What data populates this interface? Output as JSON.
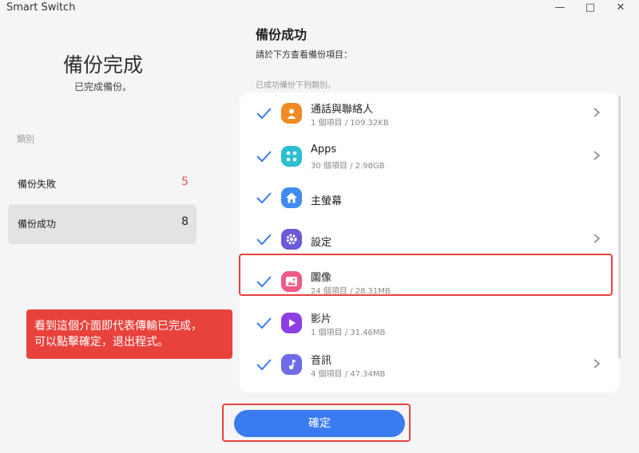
{
  "window": {
    "title": "Smart Switch",
    "controls": [
      "minimize-icon",
      "maximize-icon",
      "close-icon"
    ]
  },
  "summary": {
    "title": "備份完成",
    "subtitle": "已完成備份。",
    "category_label": "類別",
    "categories": [
      {
        "label": "備份失敗",
        "count": "5",
        "color": "#e05252",
        "selected": false
      },
      {
        "label": "備份成功",
        "count": "8",
        "color": "#222222",
        "selected": true
      }
    ]
  },
  "callout": {
    "line1": "看到這個介面即代表傳輸已完成，",
    "line2": "可以點擊確定，退出程式。"
  },
  "detail": {
    "title": "備份成功",
    "subtitle": "請於下方查看備份項目：",
    "list_header": "已成功備份下列類別。",
    "items": [
      {
        "name": "通話與聯絡人",
        "detail": "1 個項目 / 109.32KB",
        "icon": "contacts-icon",
        "color": "#f08a24",
        "expandable": true
      },
      {
        "name": "Apps",
        "detail": "30 個項目 / 2.98GB",
        "icon": "apps-icon",
        "color": "#2bbfcf",
        "expandable": true
      },
      {
        "name": "主螢幕",
        "detail": "",
        "icon": "home-icon",
        "color": "#3f8cf0",
        "expandable": false
      },
      {
        "name": "設定",
        "detail": "",
        "icon": "settings-icon",
        "color": "#6a5ad8",
        "expandable": true
      },
      {
        "name": "圖像",
        "detail": "24 個項目 / 28.31MB",
        "icon": "image-icon",
        "color": "#ef5a86",
        "expandable": false
      },
      {
        "name": "影片",
        "detail": "1 個項目 / 31.46MB",
        "icon": "video-icon",
        "color": "#8d3fe6",
        "expandable": false
      },
      {
        "name": "音訊",
        "detail": "4 個項目 / 47.34MB",
        "icon": "audio-icon",
        "color": "#6f6ce6",
        "expandable": true
      }
    ]
  },
  "confirm_button": "確定",
  "colors": {
    "accent": "#3a7bef",
    "check": "#3a7bef",
    "annotation_red": "#e8423d"
  }
}
